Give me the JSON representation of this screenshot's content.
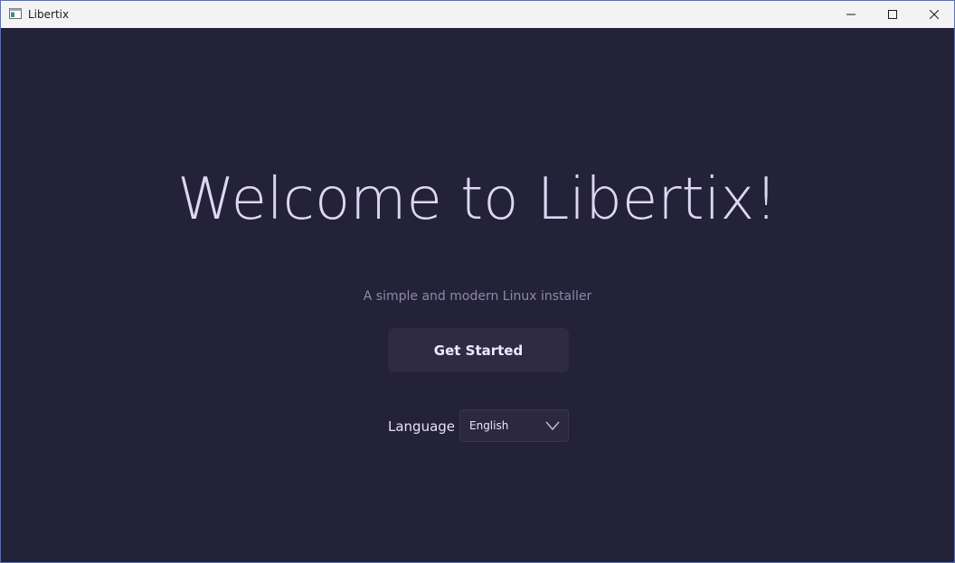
{
  "window": {
    "title": "Libertix",
    "icon": "app-window-icon",
    "controls": {
      "minimize_icon": "minimize-icon",
      "maximize_icon": "maximize-icon",
      "close_icon": "close-icon"
    }
  },
  "welcome": {
    "heading": "Welcome to Libertix!",
    "subtitle": "A simple and modern Linux installer",
    "get_started_label": "Get Started"
  },
  "language": {
    "label": "Language",
    "selected": "English",
    "chevron_icon": "chevron-down-icon"
  },
  "colors": {
    "background": "#242238",
    "heading_text": "#dcd8f4",
    "subtitle_text": "#8d89a8",
    "button_background": "#2e2b43",
    "titlebar_background": "#f3f3f3"
  }
}
